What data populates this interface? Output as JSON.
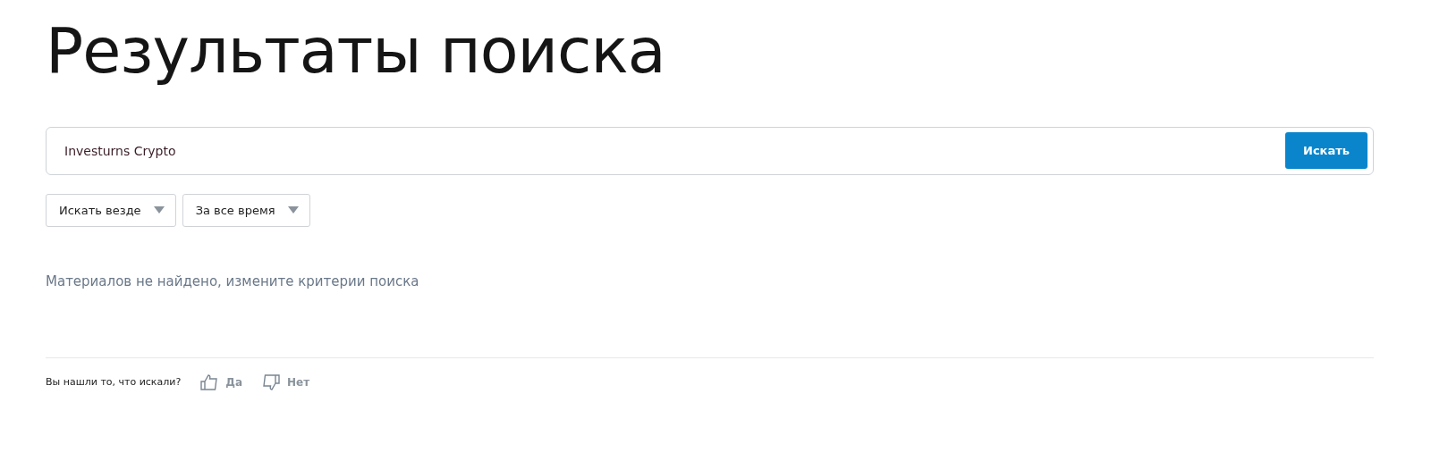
{
  "title": "Результаты поиска",
  "search": {
    "value": "Investurns Crypto",
    "button": "Искать"
  },
  "filters": [
    {
      "label": "Искать везде"
    },
    {
      "label": "За все время"
    }
  ],
  "message": "Материалов не найдено, измените критерии поиска",
  "feedback": {
    "question": "Вы нашли то, что искали?",
    "options": [
      {
        "kind": "up",
        "label": "Да"
      },
      {
        "kind": "down",
        "label": "Нет"
      }
    ]
  }
}
